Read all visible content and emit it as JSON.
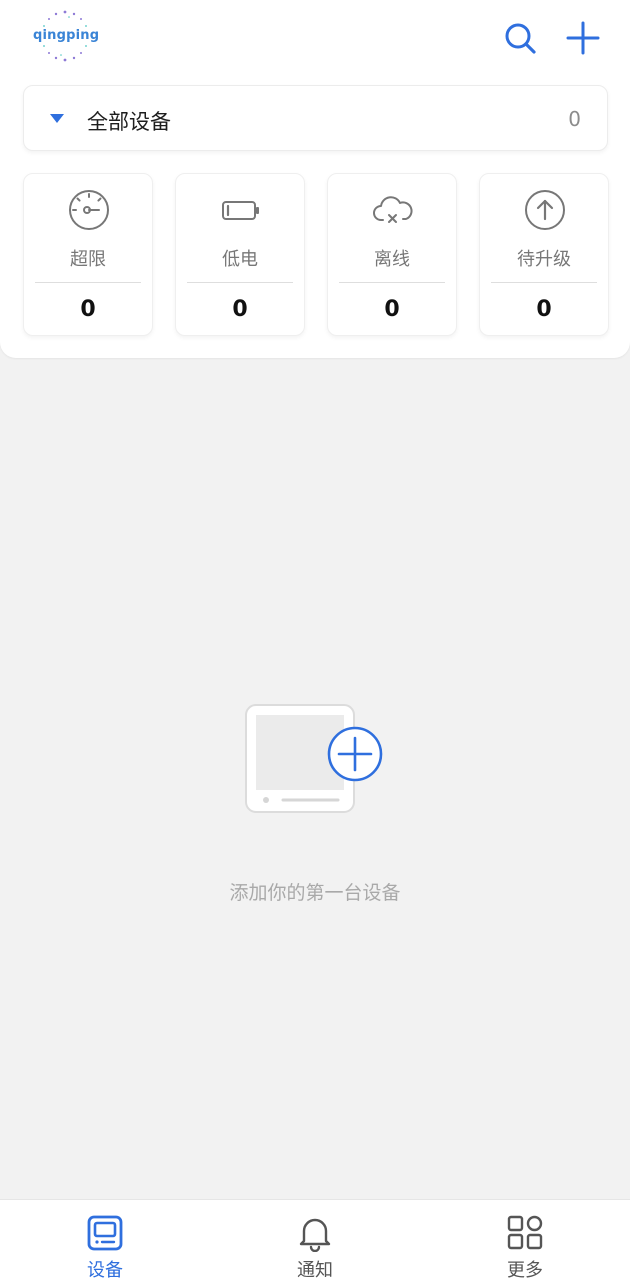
{
  "colors": {
    "accent": "#2f6fde",
    "page_background": "#f2f2f2",
    "muted_text": "#a9a9a9"
  },
  "header": {
    "logo_text": "qingping",
    "search_icon": "search-icon",
    "add_icon": "plus-icon"
  },
  "group_selector": {
    "label": "全部设备",
    "count": "0",
    "caret_icon": "caret-down-icon"
  },
  "stats": [
    {
      "label": "超限",
      "value": "0",
      "icon": "gauge-icon"
    },
    {
      "label": "低电",
      "value": "0",
      "icon": "low-battery-icon"
    },
    {
      "label": "离线",
      "value": "0",
      "icon": "cloud-offline-icon"
    },
    {
      "label": "待升级",
      "value": "0",
      "icon": "upgrade-icon"
    }
  ],
  "empty_state": {
    "text": "添加你的第一台设备",
    "icon": "add-device-illustration"
  },
  "bottom_nav": [
    {
      "label": "设备",
      "icon": "device-icon",
      "active": true
    },
    {
      "label": "通知",
      "icon": "bell-icon",
      "active": false
    },
    {
      "label": "更多",
      "icon": "grid-more-icon",
      "active": false
    }
  ]
}
